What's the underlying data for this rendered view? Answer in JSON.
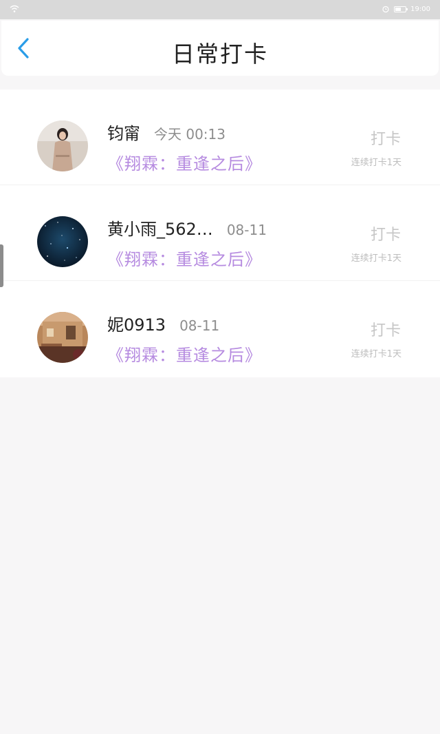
{
  "status_bar": {
    "time": "19:00"
  },
  "header": {
    "title": "日常打卡",
    "back_icon": "chevron-left-icon",
    "accent_color": "#2a9de8"
  },
  "list": {
    "items": [
      {
        "name": "钧甯",
        "time": "今天 00:13",
        "book": "《翔霖：重逢之后》",
        "action_label": "打卡",
        "streak": "连续打卡1天",
        "avatar": "avatar-woman-photo"
      },
      {
        "name": "黄小雨_562…",
        "time": "08-11",
        "book": "《翔霖：重逢之后》",
        "action_label": "打卡",
        "streak": "连续打卡1天",
        "avatar": "avatar-starry-sky"
      },
      {
        "name": "妮0913",
        "time": "08-11",
        "book": "《翔霖：重逢之后》",
        "action_label": "打卡",
        "streak": "连续打卡1天",
        "avatar": "avatar-house"
      }
    ]
  },
  "colors": {
    "book_title": "#b68be0",
    "checkin_gray": "#c6c6c6",
    "background": "#f7f6f7"
  }
}
